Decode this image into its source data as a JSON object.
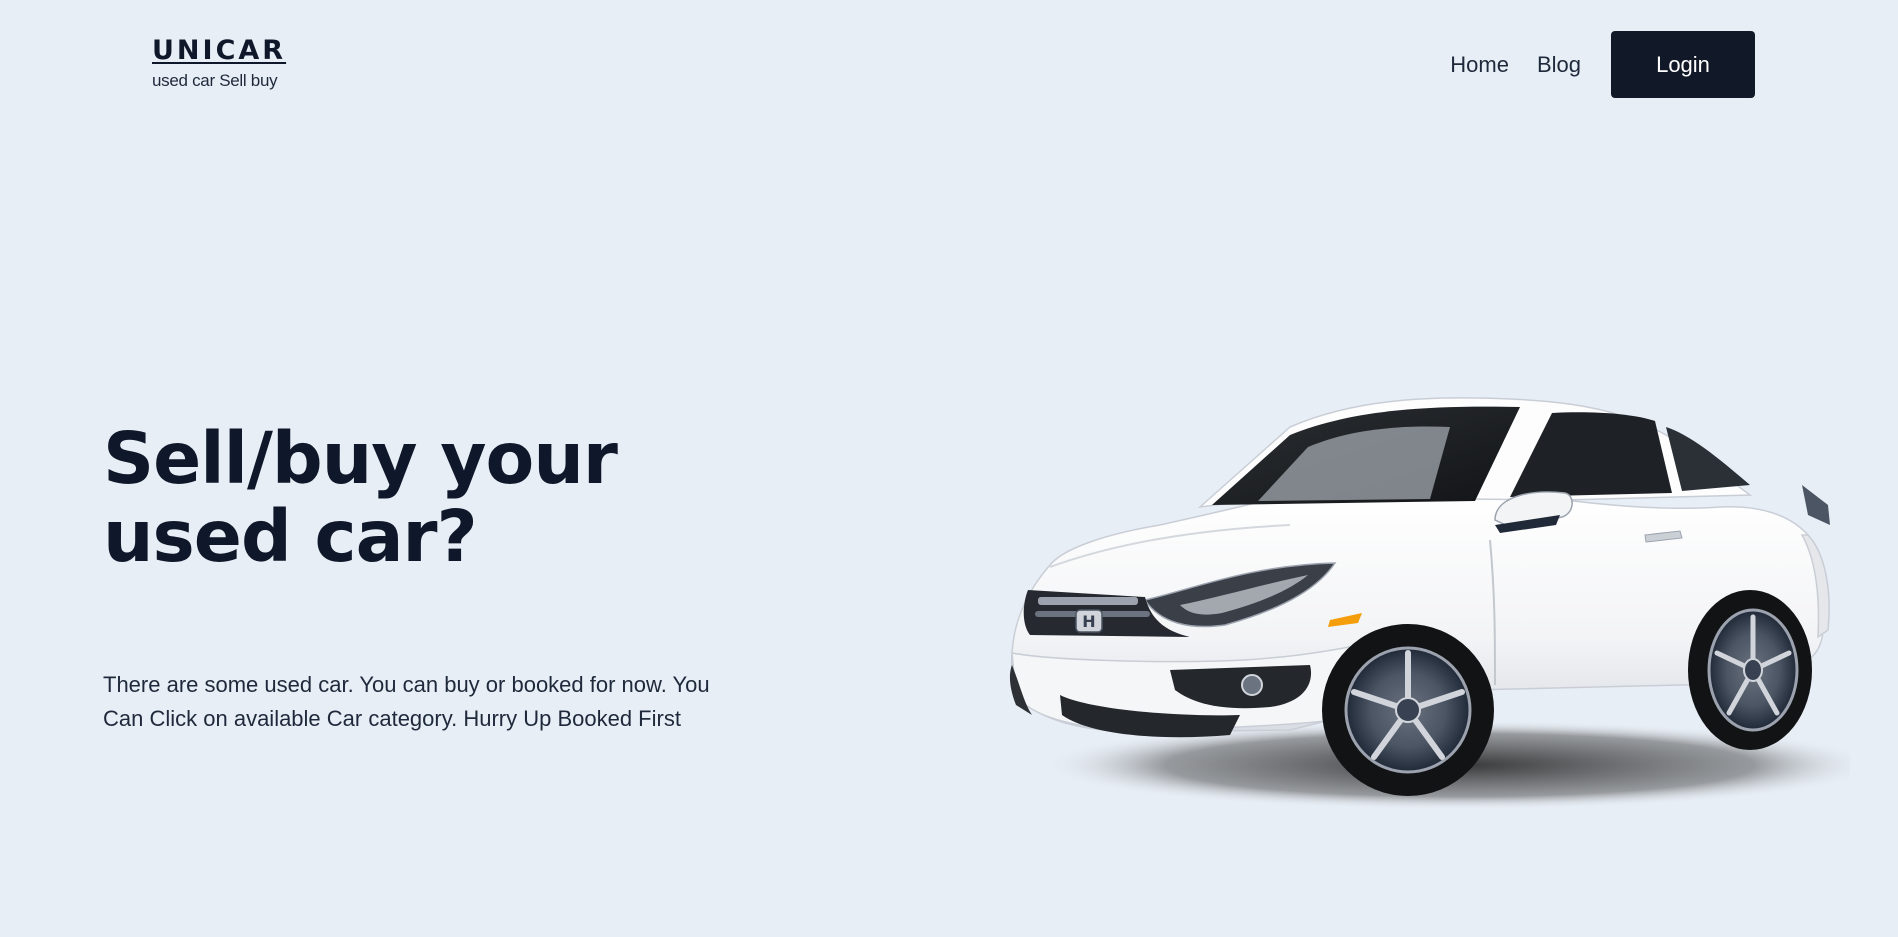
{
  "header": {
    "logo_title": "UNICAR",
    "logo_subtitle": "used car Sell buy",
    "nav": {
      "home": "Home",
      "blog": "Blog",
      "login": "Login"
    }
  },
  "hero": {
    "title": "Sell/buy your used car?",
    "description": "There are some used car. You can buy or booked for now. You Can Click on available Car category. Hurry Up Booked First",
    "image": "white-sedan-car"
  },
  "colors": {
    "background": "#e8eef5",
    "text": "#0f172a",
    "button_bg": "#111827",
    "button_text": "#ffffff"
  }
}
